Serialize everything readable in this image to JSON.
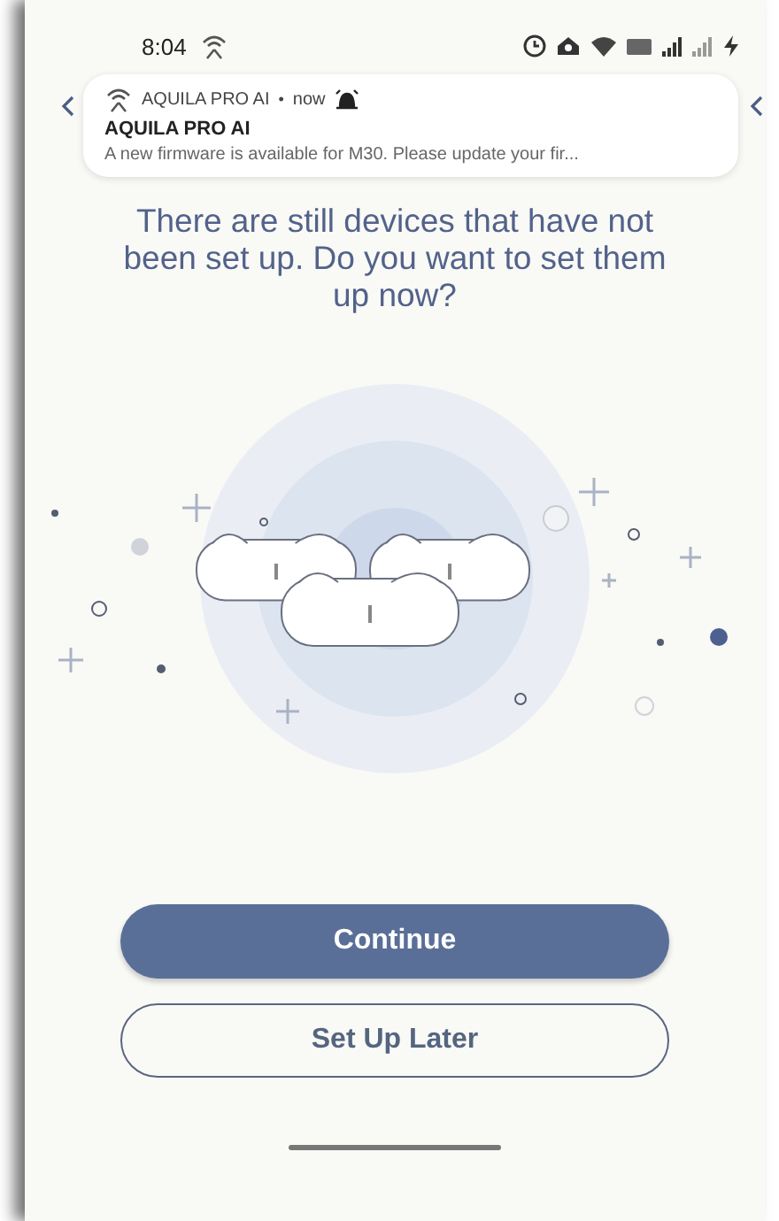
{
  "status_bar": {
    "time": "8:04"
  },
  "notification": {
    "app": "AQUILA PRO AI",
    "separator": "•",
    "time": "now",
    "title": "AQUILA PRO AI",
    "body": "A new firmware is available for M30. Please update your fir..."
  },
  "prompt": "There are still devices that have not been set up. Do you want to set them up now?",
  "buttons": [
    {
      "label": "Continue",
      "kind": "primary"
    },
    {
      "label": "Set Up Later",
      "kind": "secondary"
    }
  ]
}
